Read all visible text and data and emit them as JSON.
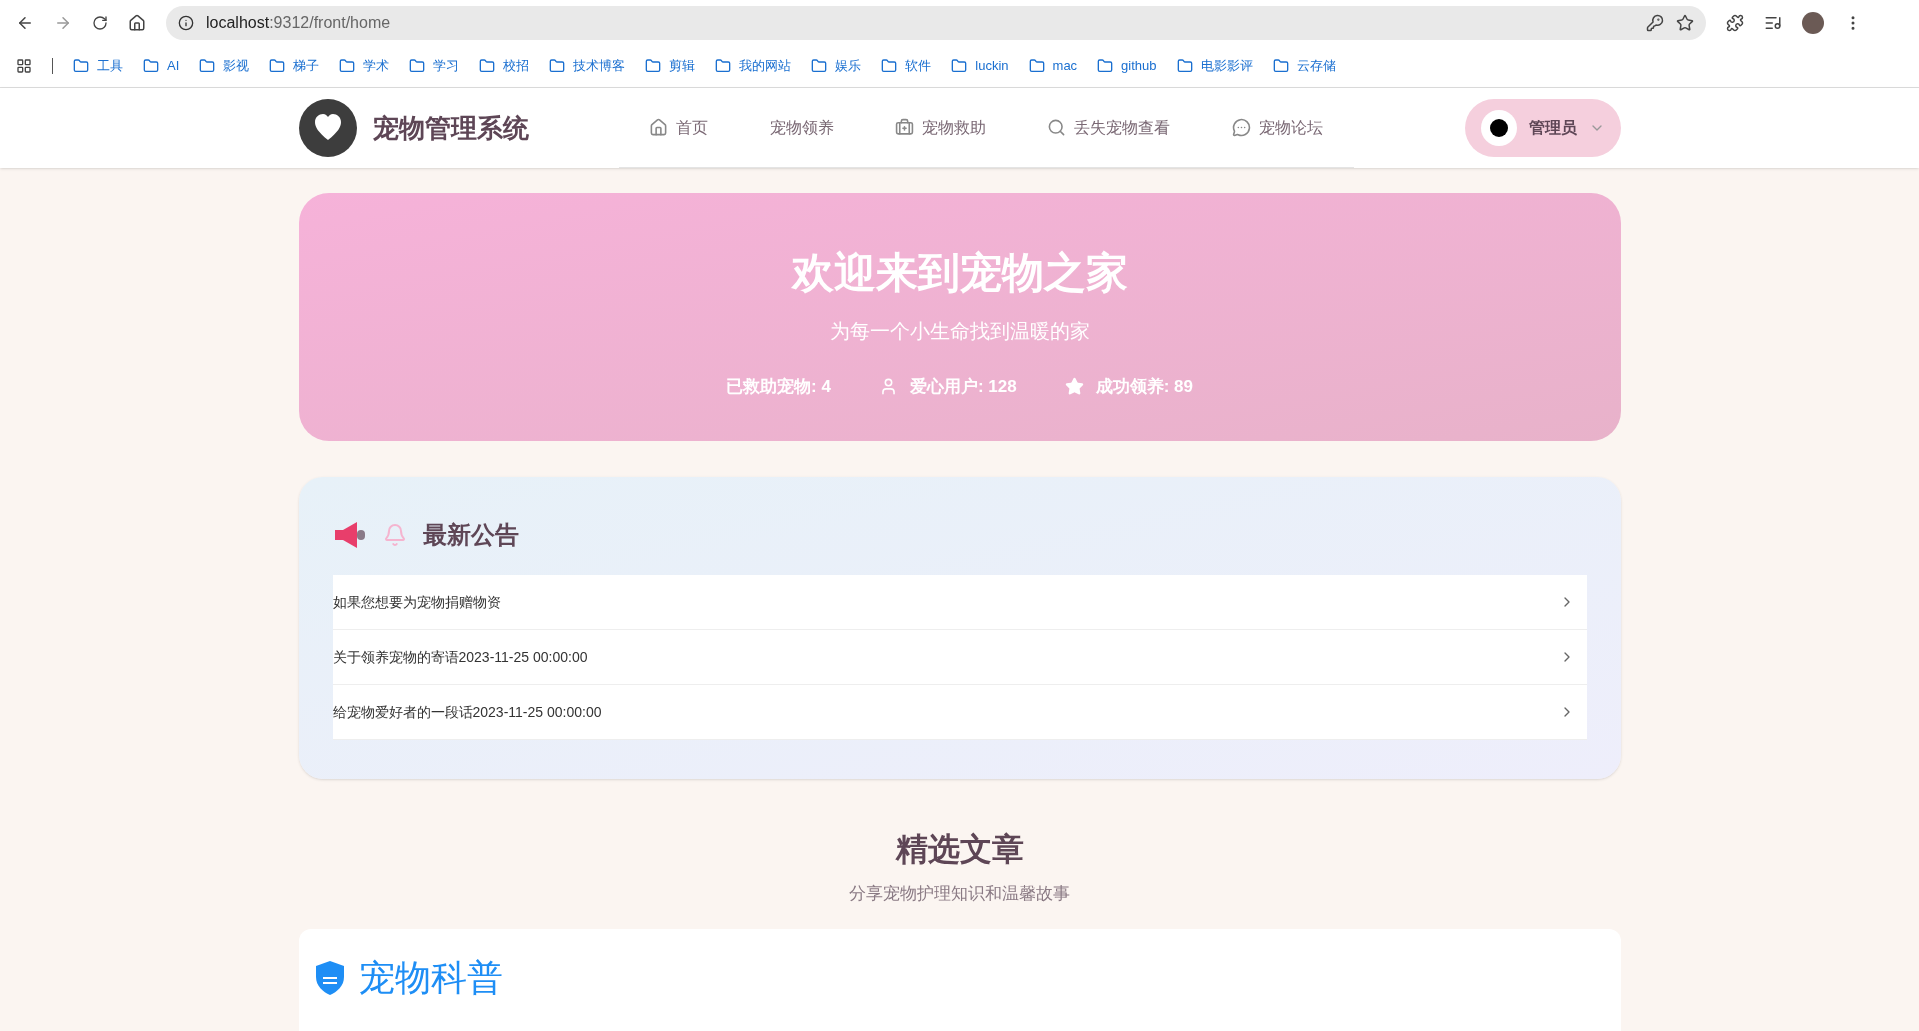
{
  "browser": {
    "url_host": "localhost",
    "url_path": ":9312/front/home",
    "bookmarks": [
      {
        "label": "工具"
      },
      {
        "label": "AI"
      },
      {
        "label": "影视"
      },
      {
        "label": "梯子"
      },
      {
        "label": "学术"
      },
      {
        "label": "学习"
      },
      {
        "label": "校招"
      },
      {
        "label": "技术博客"
      },
      {
        "label": "剪辑"
      },
      {
        "label": "我的网站"
      },
      {
        "label": "娱乐"
      },
      {
        "label": "软件"
      },
      {
        "label": "luckin"
      },
      {
        "label": "mac"
      },
      {
        "label": "github"
      },
      {
        "label": "电影影评"
      },
      {
        "label": "云存储"
      }
    ]
  },
  "header": {
    "title": "宠物管理系统",
    "nav": [
      {
        "label": "首页",
        "kind": "home"
      },
      {
        "label": "宠物领养",
        "kind": "none"
      },
      {
        "label": "宠物救助",
        "kind": "aid"
      },
      {
        "label": "丢失宠物查看",
        "kind": "search"
      },
      {
        "label": "宠物论坛",
        "kind": "chat"
      }
    ],
    "user": "管理员"
  },
  "hero": {
    "title": "欢迎来到宠物之家",
    "subtitle": "为每一个小生命找到温暖的家",
    "stats": [
      {
        "label": "已救助宠物: 4",
        "kind": "none"
      },
      {
        "label": "爱心用户: 128",
        "kind": "user"
      },
      {
        "label": "成功领养: 89",
        "kind": "star"
      }
    ]
  },
  "notices": {
    "title": "最新公告",
    "items": [
      {
        "text": "如果您想要为宠物捐赠物资"
      },
      {
        "text": "关于领养宠物的寄语2023-11-25 00:00:00"
      },
      {
        "text": "给宠物爱好者的一段话2023-11-25 00:00:00"
      }
    ]
  },
  "articles": {
    "title": "精选文章",
    "subtitle": "分享宠物护理知识和温馨故事",
    "category": "宠物科普"
  }
}
